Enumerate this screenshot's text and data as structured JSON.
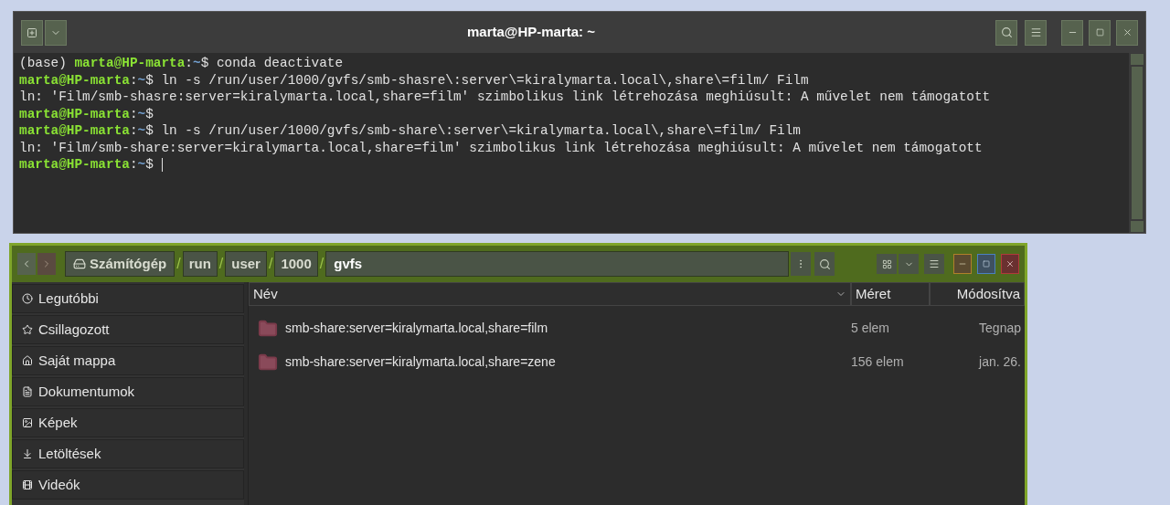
{
  "terminal": {
    "title": "marta@HP-marta: ~",
    "lines": [
      {
        "kind": "prompt",
        "prefix": "(base) ",
        "user": "marta@HP-marta",
        "colon": ":",
        "path": "~",
        "command": "$ conda deactivate",
        "cursor": false
      },
      {
        "kind": "prompt",
        "user": "marta@HP-marta",
        "colon": ":",
        "path": "~",
        "command": "$ ln -s /run/user/1000/gvfs/smb-shasre\\:server\\=kiralymarta.local\\,share\\=film/ Film",
        "cursor": false
      },
      {
        "kind": "output",
        "text": "ln: 'Film/smb-shasre:server=kiralymarta.local,share=film' szimbolikus link létrehozása meghiúsult: A művelet nem támogatott"
      },
      {
        "kind": "prompt",
        "user": "marta@HP-marta",
        "colon": ":",
        "path": "~",
        "command": "$",
        "cursor": false
      },
      {
        "kind": "prompt",
        "user": "marta@HP-marta",
        "colon": ":",
        "path": "~",
        "command": "$ ln -s /run/user/1000/gvfs/smb-share\\:server\\=kiralymarta.local\\,share\\=film/ Film",
        "cursor": false
      },
      {
        "kind": "output",
        "text": "ln: 'Film/smb-share:server=kiralymarta.local,share=film' szimbolikus link létrehozása meghiúsult: A művelet nem támogatott"
      },
      {
        "kind": "prompt",
        "user": "marta@HP-marta",
        "colon": ":",
        "path": "~",
        "command": "$",
        "cursor": true
      }
    ]
  },
  "files": {
    "path": [
      {
        "label": "Számítógép",
        "kind": "root"
      },
      {
        "label": "/",
        "kind": "sep"
      },
      {
        "label": "run",
        "kind": "dir"
      },
      {
        "label": "/",
        "kind": "sep"
      },
      {
        "label": "user",
        "kind": "dir"
      },
      {
        "label": "/",
        "kind": "sep"
      },
      {
        "label": "1000",
        "kind": "dir"
      },
      {
        "label": "/",
        "kind": "sep"
      },
      {
        "label": "gvfs",
        "kind": "current"
      }
    ],
    "sidebar": [
      {
        "label": "Legutóbbi",
        "kind": "recent"
      },
      {
        "label": "Csillagozott",
        "kind": "starred"
      },
      {
        "label": "Saját mappa",
        "kind": "home"
      },
      {
        "label": "Dokumentumok",
        "kind": "documents"
      },
      {
        "label": "Képek",
        "kind": "pictures"
      },
      {
        "label": "Letöltések",
        "kind": "downloads"
      },
      {
        "label": "Videók",
        "kind": "videos"
      }
    ],
    "columns": [
      "Név",
      "Méret",
      "Módosítva"
    ],
    "rows": [
      {
        "name": "smb-share:server=kiralymarta.local,share=film",
        "size": "5 elem",
        "modified": "Tegnap"
      },
      {
        "name": "smb-share:server=kiralymarta.local,share=zene",
        "size": "156 elem",
        "modified": "jan. 26."
      }
    ]
  }
}
